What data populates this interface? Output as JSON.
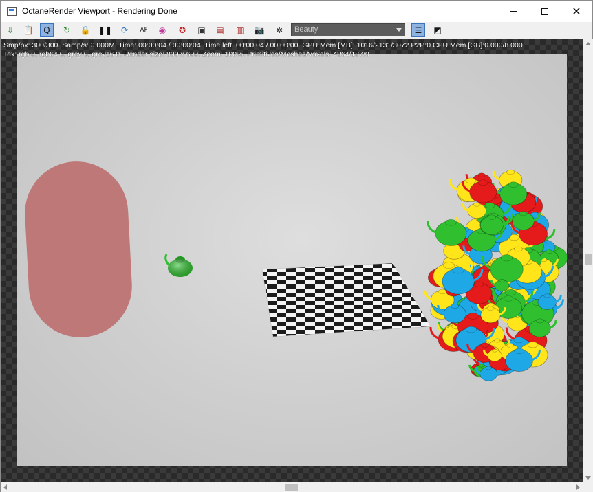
{
  "window": {
    "title": "OctaneRender Viewport - Rendering Done",
    "minimize_glyph": "",
    "close_glyph": "✕"
  },
  "toolbar": {
    "buttons": [
      {
        "icon": "export-icon",
        "glyph": "⇩",
        "color": "#2e7d32"
      },
      {
        "icon": "clipboard-icon",
        "glyph": "📋",
        "color": "#555555"
      },
      {
        "icon": "quick-render-icon",
        "glyph": "Q",
        "color": "#1a1a1a",
        "active": true
      },
      {
        "icon": "restart-render-icon",
        "glyph": "↻",
        "color": "#2e8b2e"
      },
      {
        "icon": "lock-icon",
        "glyph": "🔒",
        "color": "#333333"
      },
      {
        "icon": "pause-icon",
        "glyph": "❚❚",
        "color": "#111111"
      },
      {
        "icon": "refresh-icon",
        "glyph": "⟳",
        "color": "#2a70b8"
      },
      {
        "icon": "focus-picker-icon",
        "glyph": "AF",
        "color": "#111111"
      },
      {
        "icon": "color-picker-icon",
        "glyph": "◉",
        "color": "#c0399b"
      },
      {
        "icon": "material-picker-icon",
        "glyph": "✪",
        "color": "#c62828"
      },
      {
        "icon": "display-settings-icon",
        "glyph": "▣",
        "color": "#333333"
      },
      {
        "icon": "region-render-icon",
        "glyph": "▤",
        "color": "#b03030"
      },
      {
        "icon": "film-region-icon",
        "glyph": "▥",
        "color": "#b03030"
      },
      {
        "icon": "camera-icon",
        "glyph": "📷",
        "color": "#b03030"
      },
      {
        "icon": "settings-gear-icon",
        "glyph": "✲",
        "color": "#333333"
      }
    ],
    "pass_select": "Beauty",
    "view_buttons": [
      {
        "icon": "list-view-icon",
        "glyph": "☰",
        "color": "#1a1a1a",
        "active": true
      },
      {
        "icon": "image-view-icon",
        "glyph": "◩",
        "color": "#1a1a1a"
      }
    ]
  },
  "status": {
    "line1": "Smp/px: 300/300.   Samp/s: 0.000M.   Time: 00:00:04 / 00:00:04.   Time left: 00:00:04 / 00:00:00.   GPU Mem [MB]: 1016/2131/3072 P2P:0   CPU Mem [GB]:0.000/8.000",
    "line2": "Tex: rgb 0, rgb64 0, grey 0, grey16 0.   Render size: 800 x 600.   Zoom: 100%.   Primitives/Meshes/Voxels: 4864/187/0"
  }
}
